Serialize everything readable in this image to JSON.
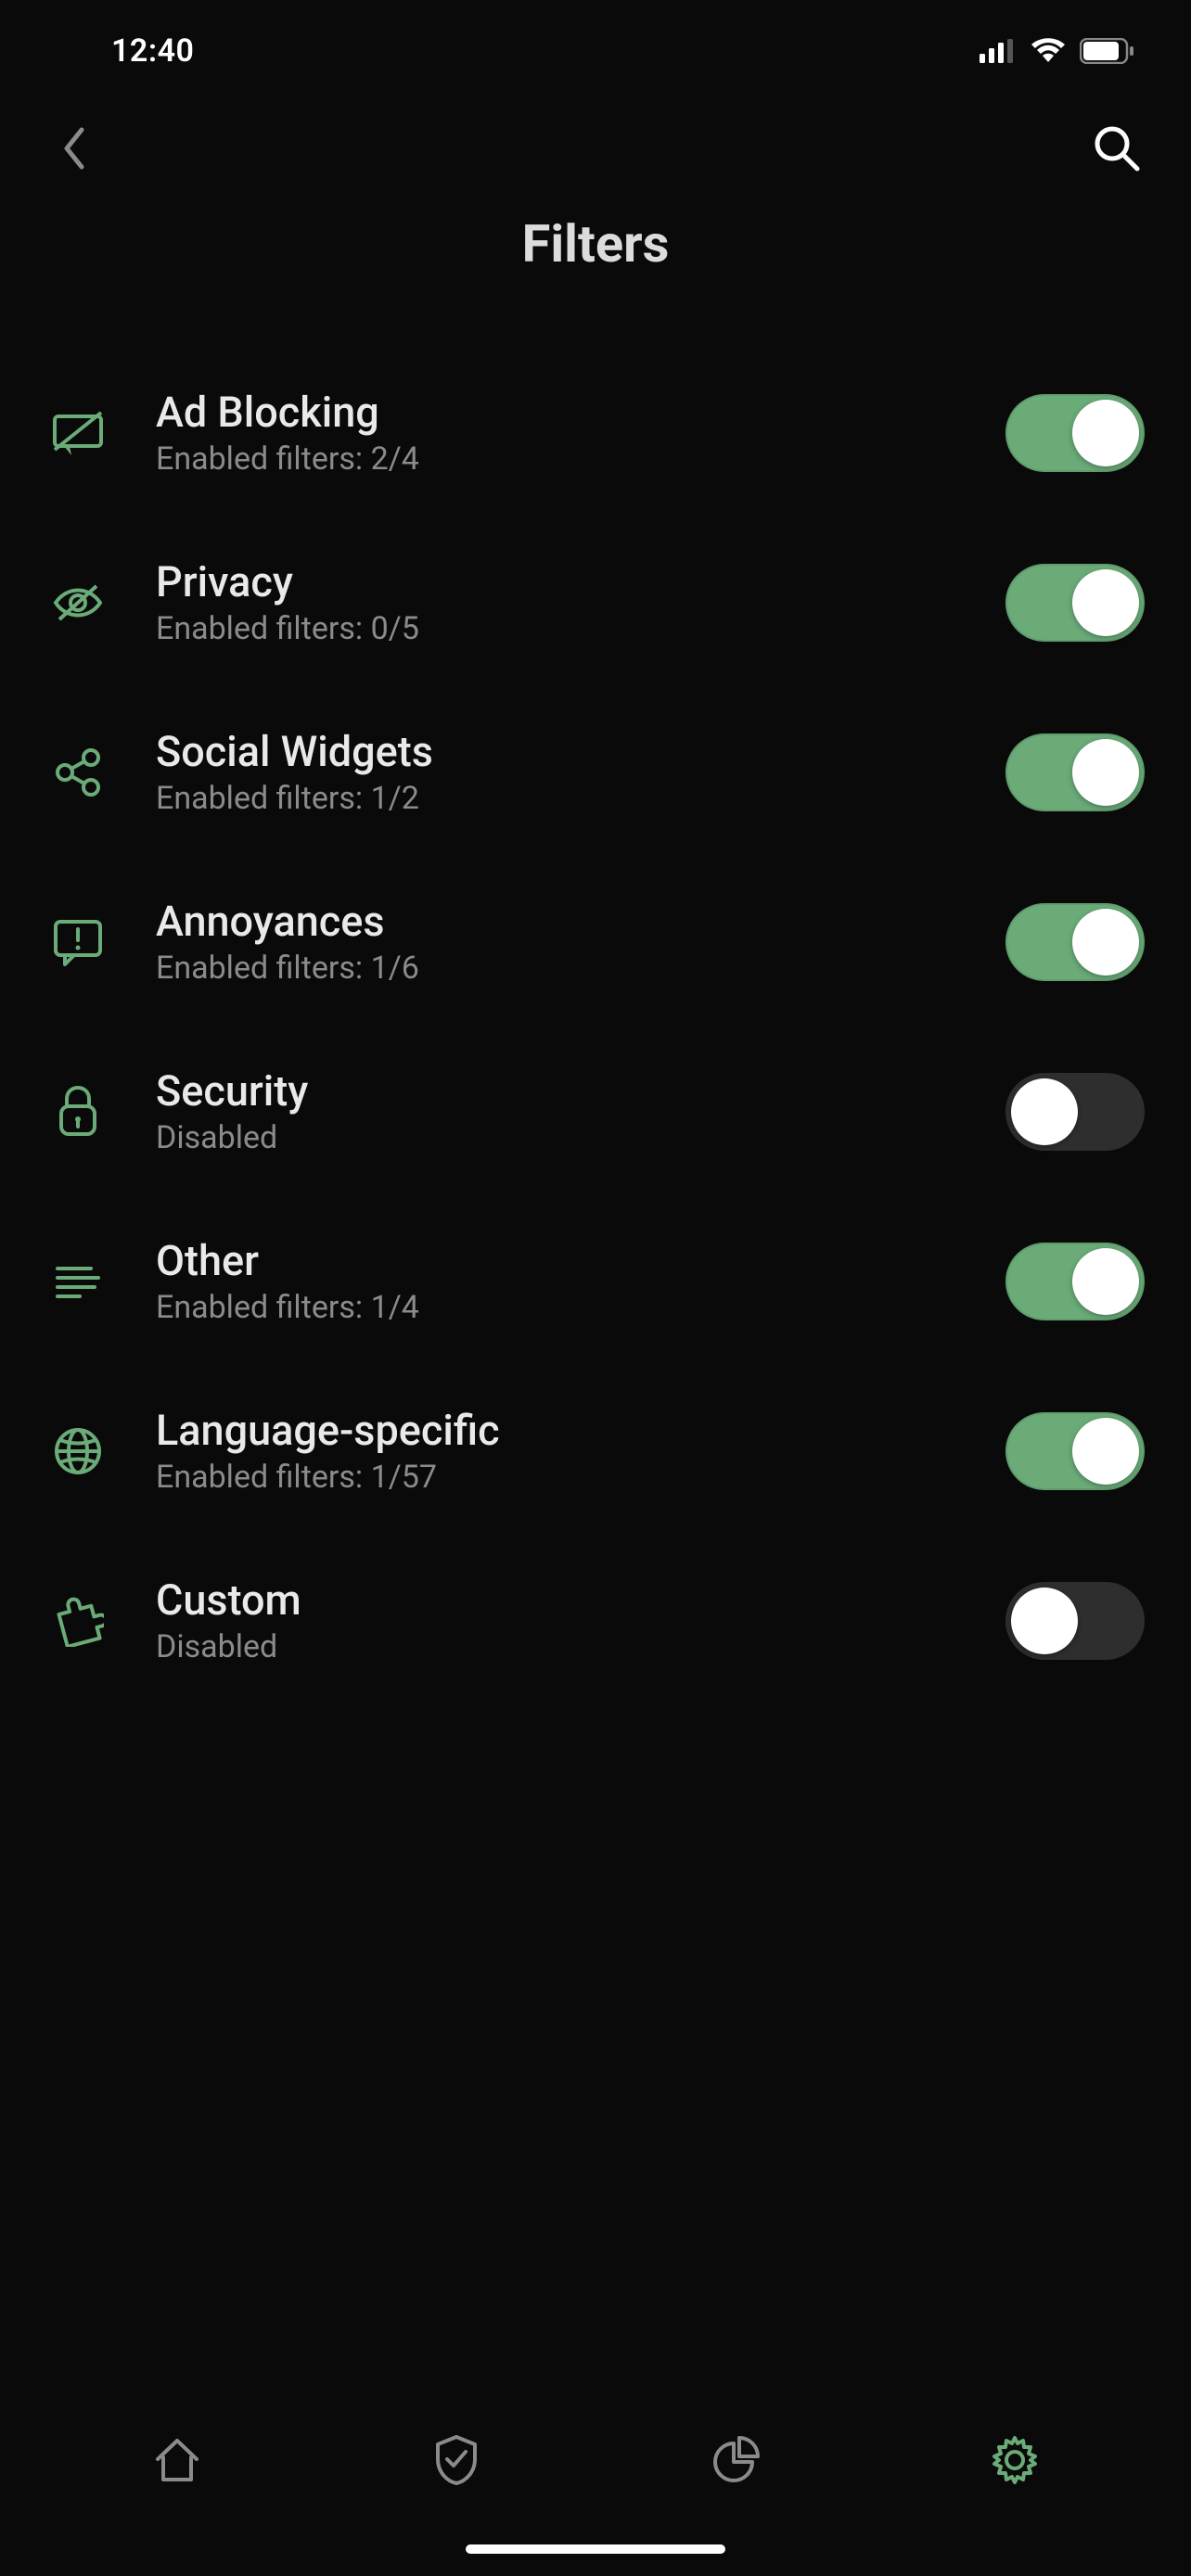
{
  "status": {
    "time": "12:40"
  },
  "nav": {
    "title": "Filters"
  },
  "filters": [
    {
      "id": "ad-blocking",
      "title": "Ad Blocking",
      "subtitle": "Enabled filters: 2/4",
      "enabled": true,
      "icon": "ad-block-icon"
    },
    {
      "id": "privacy",
      "title": "Privacy",
      "subtitle": "Enabled filters: 0/5",
      "enabled": true,
      "icon": "privacy-icon"
    },
    {
      "id": "social-widgets",
      "title": "Social Widgets",
      "subtitle": "Enabled filters: 1/2",
      "enabled": true,
      "icon": "share-icon"
    },
    {
      "id": "annoyances",
      "title": "Annoyances",
      "subtitle": "Enabled filters: 1/6",
      "enabled": true,
      "icon": "alert-bubble-icon"
    },
    {
      "id": "security",
      "title": "Security",
      "subtitle": "Disabled",
      "enabled": false,
      "icon": "lock-icon"
    },
    {
      "id": "other",
      "title": "Other",
      "subtitle": "Enabled filters: 1/4",
      "enabled": true,
      "icon": "lines-icon"
    },
    {
      "id": "language-specific",
      "title": "Language-specific",
      "subtitle": "Enabled filters: 1/57",
      "enabled": true,
      "icon": "globe-icon"
    },
    {
      "id": "custom",
      "title": "Custom",
      "subtitle": "Disabled",
      "enabled": false,
      "icon": "puzzle-icon"
    }
  ],
  "colors": {
    "accent": "#6aab78",
    "background": "#0a0a0a",
    "toggle_off": "#2e2e2e"
  },
  "tabs": {
    "active": "settings"
  }
}
